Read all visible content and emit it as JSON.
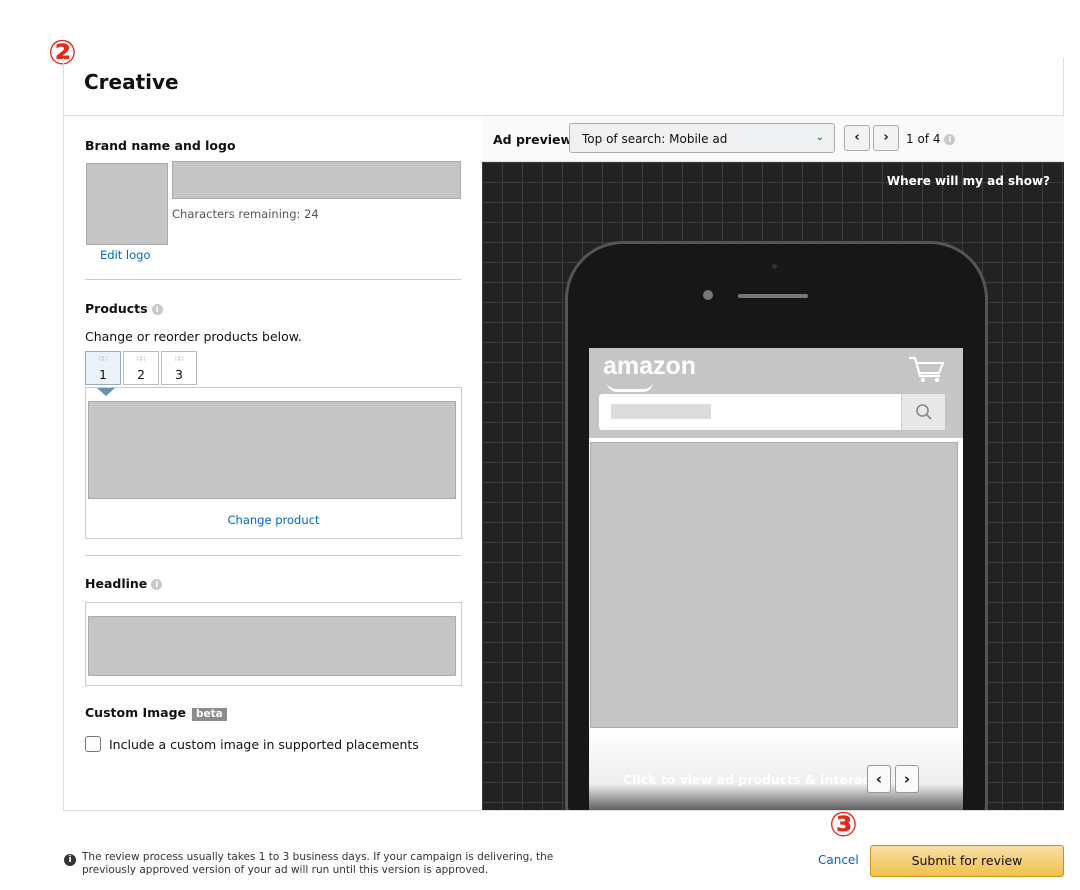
{
  "markers": {
    "step2": "②",
    "step3": "③"
  },
  "creative": {
    "title": "Creative",
    "brand": {
      "heading": "Brand name and logo",
      "chars_remaining": "Characters remaining: 24",
      "edit_logo": "Edit logo"
    },
    "products": {
      "heading": "Products",
      "subtitle": "Change or reorder products below.",
      "tabs": [
        "1",
        "2",
        "3"
      ],
      "active_tab": "1",
      "change_product": "Change product"
    },
    "headline": {
      "heading": "Headline"
    },
    "custom_image": {
      "heading": "Custom Image",
      "badge": "beta",
      "checkbox_label": "Include a custom image in supported placements",
      "checked": false
    }
  },
  "preview": {
    "label": "Ad preview",
    "selected_placement": "Top of search: Mobile ad",
    "prev_icon": "chevron-left-icon",
    "next_icon": "chevron-right-icon",
    "page_count": "1 of 4",
    "where_link": "Where will my ad show?",
    "mock": {
      "store_logo": "amazon",
      "strip_text": "Click to view ad products & interaction"
    }
  },
  "footer": {
    "note": "The review process usually takes 1 to 3 business days. If your campaign is delivering, the previously approved version of your ad will run until this version is approved.",
    "cancel": "Cancel",
    "submit": "Submit for review"
  },
  "colors": {
    "link": "#0066c0",
    "marker": "#e3291b",
    "submit_bg": "#f0c14b",
    "canvas_bg": "#222222"
  }
}
